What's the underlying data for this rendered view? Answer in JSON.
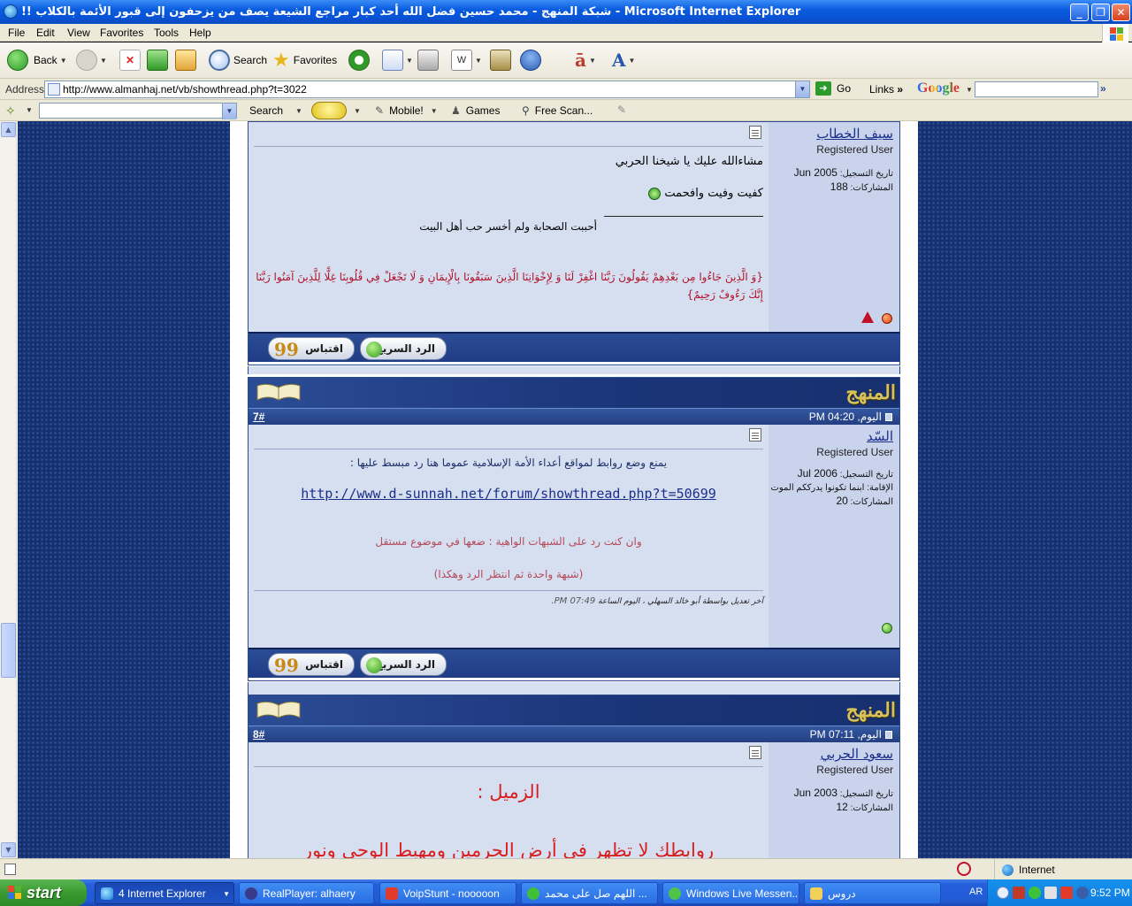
{
  "window": {
    "title": "!! شبكة المنهج - محمد حسين فضل الله أحد كبار مراجع الشيعة يصف من يزحفون إلى قبور الأئمة بالكلاب - Microsoft Internet Explorer",
    "minimize": "_",
    "maximize": "❐",
    "close": "✕"
  },
  "menu": [
    "File",
    "Edit",
    "View",
    "Favorites",
    "Tools",
    "Help"
  ],
  "toolbar": {
    "back": "Back",
    "search": "Search",
    "favorites": "Favorites"
  },
  "address": {
    "label": "Address",
    "url": "http://www.almanhaj.net/vb/showthread.php?t=3022",
    "go": "Go",
    "links": "Links",
    "chevron": "»",
    "google": "Google"
  },
  "toolbar2": {
    "search": "Search",
    "mobile": "Mobile!",
    "games": "Games",
    "free_scan": "Free Scan..."
  },
  "forum": {
    "logo": "المنهج",
    "quick_reply": "الرد السريع",
    "quote": "اقتباس",
    "quote_mark": "99",
    "registered_label": "تاريخ التسجيل:",
    "posts_label": "المشاركات:",
    "location_label": "الإقامة:",
    "posts": [
      {
        "username": "سيف الخطاب",
        "user_title": "Registered User",
        "join_date": "Jun 2005",
        "post_count": "188",
        "lines": [
          "مشاءالله عليك يا شيخنا الحربي",
          "كفيت وفيت وافحمت",
          "أحببت الصحابة ولم أخسر حب أهل البيت",
          "{وَ الَّذِينَ جَاءُوا مِن بَعْدِهِمْ يَقُولُونَ رَبَّنَا اغْفِرْ لَنَا وَ لِإِخْوَانِنَا الَّذِينَ سَبَقُونَا بِالْإِيمَانِ وَ لَا تَجْعَلْ فِي قُلُوبِنَا غِلًّا لِلَّذِينَ آمَنُوا",
          "رَبَّنَا إِنَّكَ رَءُوفٌ رَحِيمٌ}"
        ]
      },
      {
        "number": "7#",
        "time": "اليوم, 04:20 PM",
        "username": "السّد",
        "user_title": "Registered User",
        "join_date": "Jul 2006",
        "location": "ابنما تكونوا يدرككم الموت",
        "post_count": "20",
        "lines": [
          "يمنع وضع روابط لمواقع أعداء الأمة الإسلامية عموما هنا رد مبسط عليها :",
          "http://www.d-sunnah.net/forum/showthread.php?t=50699",
          "وان كنت رد على الشبهات الواهية : ضعها في موضوع مستقل",
          "(شبهة واحدة ثم انتظر الرد وهكذا)",
          "آخر تعديل بواسطة أبو خالد السهلي ، اليوم الساعة",
          "07:49 PM."
        ]
      },
      {
        "number": "8#",
        "time": "اليوم, 07:11 PM",
        "username": "سعود الحربي",
        "user_title": "Registered User",
        "join_date": "Jun 2003",
        "post_count": "12",
        "lines": [
          "الزميل :",
          "روابطك لا تظهر في أرض الحرمين ومهبط الوحي ونور"
        ]
      }
    ]
  },
  "status": {
    "zone": "Internet"
  },
  "taskbar": {
    "start": "start",
    "tasks": [
      "4 Internet Explorer",
      "RealPlayer: alhaery",
      "VoipStunt - nooooon",
      "اللهم صل على محمد ...",
      "Windows Live Messen...",
      "دروس"
    ],
    "lang": "AR",
    "clock": "9:52 PM"
  },
  "colors": {
    "forum_blue": "#1a3478",
    "post_bg": "#d6dff0",
    "sidebar_bg": "#c9d4ec",
    "link": "#1b2f8a",
    "quran_red": "#b0122a",
    "mod_red": "#b44a5c"
  }
}
